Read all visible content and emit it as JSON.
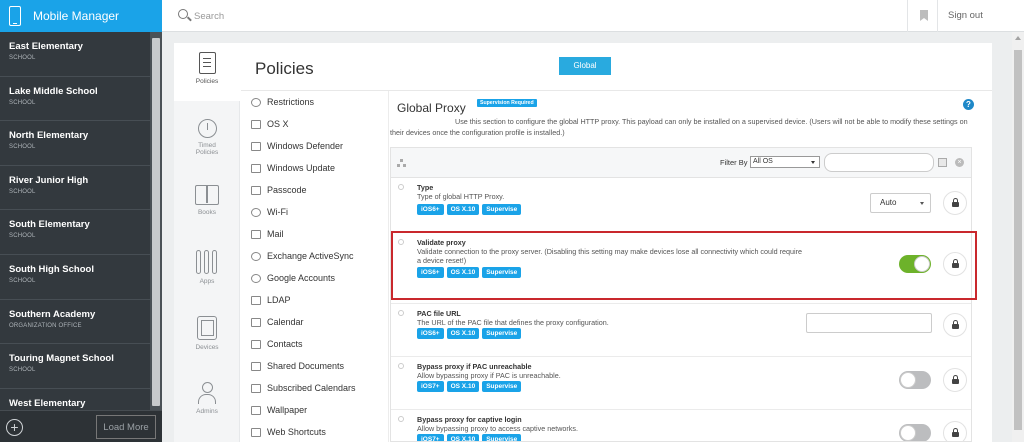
{
  "app": {
    "title": "Mobile Manager"
  },
  "search": {
    "placeholder": "Search"
  },
  "topbar": {
    "signout_label": "Sign out"
  },
  "schools": [
    {
      "name": "East Elementary",
      "type": "SCHOOL"
    },
    {
      "name": "Lake Middle School",
      "type": "SCHOOL"
    },
    {
      "name": "North Elementary",
      "type": "SCHOOL"
    },
    {
      "name": "River Junior High",
      "type": "SCHOOL"
    },
    {
      "name": "South Elementary",
      "type": "SCHOOL"
    },
    {
      "name": "South High School",
      "type": "SCHOOL"
    },
    {
      "name": "Southern Academy",
      "type": "ORGANIZATION OFFICE"
    },
    {
      "name": "Touring Magnet School",
      "type": "SCHOOL"
    },
    {
      "name": "West Elementary",
      "type": ""
    }
  ],
  "footer": {
    "load_more_label": "Load More",
    "add_icon": "plus-circle-icon"
  },
  "rail": [
    {
      "label": "Policies",
      "icon": "clipboard-icon",
      "active": true
    },
    {
      "label": "Timed Policies",
      "icon": "timer-icon"
    },
    {
      "label": "Books",
      "icon": "book-icon"
    },
    {
      "label": "Apps",
      "icon": "apps-icon"
    },
    {
      "label": "Devices",
      "icon": "tablet-icon"
    },
    {
      "label": "Admins",
      "icon": "user-icon"
    }
  ],
  "page": {
    "title": "Policies",
    "global_button": "Global"
  },
  "policy_list": [
    "Restrictions",
    "OS X",
    "Windows Defender",
    "Windows Update",
    "Passcode",
    "Wi-Fi",
    "Mail",
    "Exchange ActiveSync",
    "Google Accounts",
    "LDAP",
    "Calendar",
    "Contacts",
    "Shared Documents",
    "Subscribed Calendars",
    "Wallpaper",
    "Web Shortcuts"
  ],
  "section": {
    "title": "Global Proxy",
    "badge": "Supervision Required",
    "description": "Use this section to configure the global HTTP proxy. This payload can only be installed on a supervised device. (Users will not be able to modify these settings on their devices once the configuration profile is installed.)"
  },
  "filter": {
    "label": "Filter By",
    "value": "All OS"
  },
  "settings": [
    {
      "title": "Type",
      "desc": "Type of global HTTP Proxy.",
      "tags": [
        "iOS6+",
        "OS X.10",
        "Supervise"
      ],
      "control": "dropdown",
      "value": "Auto"
    },
    {
      "title": "Validate proxy",
      "desc": "Validate connection to the proxy server. (Disabling this setting may make devices lose all connectivity which could require a device reset!)",
      "tags": [
        "iOS6+",
        "OS X.10",
        "Supervise"
      ],
      "control": "toggle",
      "value": "on"
    },
    {
      "title": "PAC file URL",
      "desc": "The URL of the PAC file that defines the proxy configuration.",
      "tags": [
        "iOS6+",
        "OS X.10",
        "Supervise"
      ],
      "control": "text",
      "value": ""
    },
    {
      "title": "Bypass proxy if PAC unreachable",
      "desc": "Allow bypassing proxy if PAC is unreachable.",
      "tags": [
        "iOS7+",
        "OS X.10",
        "Supervise"
      ],
      "control": "toggle",
      "value": "off"
    },
    {
      "title": "Bypass proxy for captive login",
      "desc": "Allow bypassing proxy to access captive networks.",
      "tags": [
        "iOS7+",
        "OS X.10",
        "Supervise"
      ],
      "control": "toggle",
      "value": "off"
    }
  ],
  "colors": {
    "accent": "#1aa3e8",
    "toggle_on": "#6db22a",
    "highlight": "#c9282d",
    "sidebar": "#33393e"
  }
}
